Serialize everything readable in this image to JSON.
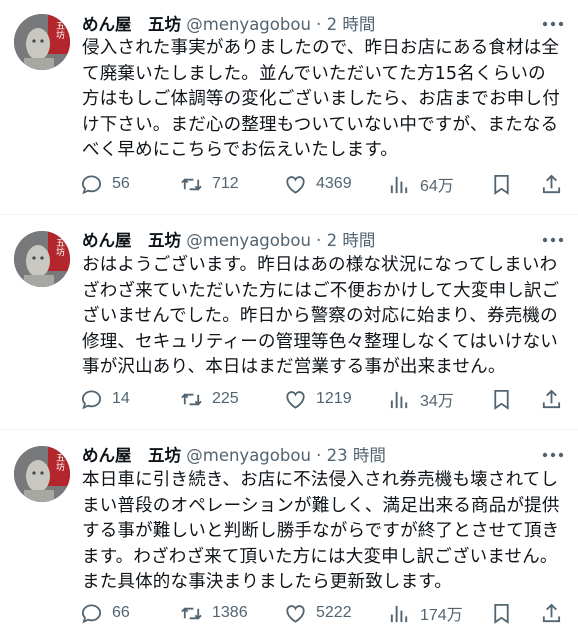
{
  "tweets": [
    {
      "name": "めん屋　五坊",
      "handle": "@menyagobou",
      "time": "2 時間",
      "text": "侵入された事実がありましたので、昨日お店にある食材は全\nて廃棄いたしました。並んでいただいてた方15名くらいの\n方はもしご体調等の変化ございましたら、お店までお申し付\nけ下さい。まだ心の整理もついていない中ですが、またなる\nべく早めにこちらでお伝えいたします。",
      "replies": "56",
      "retweets": "712",
      "likes": "4369",
      "views": "64万"
    },
    {
      "name": "めん屋　五坊",
      "handle": "@menyagobou",
      "time": "2 時間",
      "text": "おはようございます。昨日はあの様な状況になってしまいわ\nざわざ来ていただいた方にはご不便おかけして大変申し訳ご\nざいませんでした。昨日から警察の対応に始まり、券売機の\n修理、セキュリティーの管理等色々整理しなくてはいけない\n事が沢山あり、本日はまだ営業する事が出来ません。",
      "replies": "14",
      "retweets": "225",
      "likes": "1219",
      "views": "34万"
    },
    {
      "name": "めん屋　五坊",
      "handle": "@menyagobou",
      "time": "23 時間",
      "text": "本日車に引き続き、お店に不法侵入され券売機も壊されてし\nまい普段のオペレーションが難しく、満足出来る商品が提供\nする事が難しいと判断し勝手ながらですが終了とさせて頂き\nます。わざわざ来て頂いた方には大変申し訳ございません。\nまた具体的な事決まりましたら更新致します。",
      "replies": "66",
      "retweets": "1386",
      "likes": "5222",
      "views": "174万"
    }
  ],
  "avatar_badge": "五坊",
  "icons": [
    "more-icon",
    "reply-icon",
    "retweet-icon",
    "like-icon",
    "views-icon",
    "bookmark-icon",
    "share-icon"
  ],
  "colors": {
    "text": "#0f1419",
    "secondary": "#536471",
    "divider": "#eff3f4",
    "avatar_red": "#b3262b"
  }
}
